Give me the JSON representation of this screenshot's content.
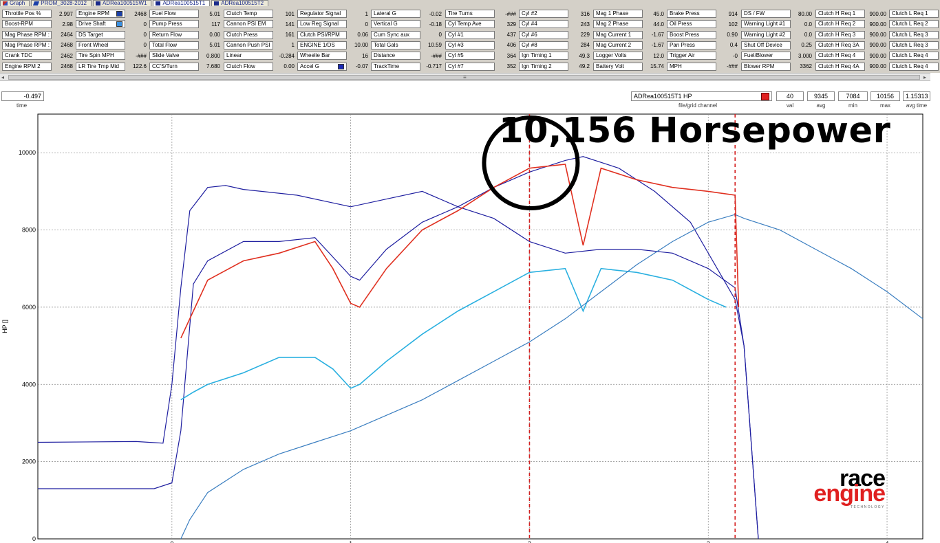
{
  "tabs": [
    {
      "label": "Graph",
      "icon": "graph-icon",
      "active": false
    },
    {
      "label": "PROM_3028-2012",
      "icon": "pencil-icon",
      "active": false
    },
    {
      "label": "ADRea100515W1",
      "icon": "box-icon",
      "active": false
    },
    {
      "label": "ADRea100515T1",
      "icon": "box-icon",
      "active": true
    },
    {
      "label": "ADRea100515T2",
      "icon": "box-icon",
      "active": false
    }
  ],
  "channel_grid": [
    [
      {
        "label": "Throttle Pos %",
        "value": "2.997"
      },
      {
        "label": "Boost-RPM",
        "value": "2.98"
      },
      {
        "label": "Mag Phase RPM :",
        "value": "2464"
      },
      {
        "label": "Mag Phase RPM :",
        "value": "2468"
      },
      {
        "label": "Crank TDC",
        "value": "2462"
      },
      {
        "label": "Engine RPM 2",
        "value": "2468"
      }
    ],
    [
      {
        "label": "Engine RPM",
        "value": "2468",
        "swatch": "#1a3fa8"
      },
      {
        "label": "Drive Shaft",
        "value": "0",
        "swatch": "#3a8fe0"
      },
      {
        "label": "DS Target",
        "value": "0"
      },
      {
        "label": "Front Wheel",
        "value": "0"
      },
      {
        "label": "Tire Spin MPH",
        "value": "-###"
      },
      {
        "label": "LR Tire Tmp Mid",
        "value": "122.6"
      }
    ],
    [
      {
        "label": "Fuel Flow",
        "value": "5.01"
      },
      {
        "label": "Pump Press",
        "value": "117"
      },
      {
        "label": "Return Flow",
        "value": "0.00"
      },
      {
        "label": "Total Flow",
        "value": "5.01"
      },
      {
        "label": "Slide Valve",
        "value": "0.800"
      },
      {
        "label": "CC'S/Turn",
        "value": "7.680"
      }
    ],
    [
      {
        "label": "Clutch Temp",
        "value": "101"
      },
      {
        "label": "Cannon PSI EM",
        "value": "141"
      },
      {
        "label": "Clutch Press",
        "value": "161"
      },
      {
        "label": "Cannon Push PSI",
        "value": "1"
      },
      {
        "label": "Linear",
        "value": "-0.284"
      },
      {
        "label": "Clutch Flow",
        "value": "0.00"
      }
    ],
    [
      {
        "label": "Regulator Signal",
        "value": "1"
      },
      {
        "label": "Low Reg Signal",
        "value": "0"
      },
      {
        "label": "Clutch PSI/RPM",
        "value": "0.06"
      },
      {
        "label": "ENGINE 1/DS",
        "value": "10.00"
      },
      {
        "label": "Wheelie Bar",
        "value": "16"
      },
      {
        "label": "Accel G",
        "value": "-0.07",
        "swatch": "#1a2ab8"
      }
    ],
    [
      {
        "label": "Lateral G",
        "value": "-0.02"
      },
      {
        "label": "Vertical G",
        "value": "-0.18"
      },
      {
        "label": "Cum Sync aux",
        "value": "0"
      },
      {
        "label": "Total Gals",
        "value": "10.59"
      },
      {
        "label": "Distance",
        "value": "-###"
      },
      {
        "label": "TrackTime",
        "value": "-0.717"
      }
    ],
    [
      {
        "label": "Tire Turns",
        "value": "-###"
      },
      {
        "label": "Cyl Temp Ave",
        "value": "329"
      },
      {
        "label": "Cyl #1",
        "value": "437"
      },
      {
        "label": "Cyl #3",
        "value": "406"
      },
      {
        "label": "Cyl #5",
        "value": "364"
      },
      {
        "label": "Cyl #7",
        "value": "352"
      }
    ],
    [
      {
        "label": "Cyl #2",
        "value": "316"
      },
      {
        "label": "Cyl #4",
        "value": "243"
      },
      {
        "label": "Cyl #6",
        "value": "229"
      },
      {
        "label": "Cyl #8",
        "value": "284"
      },
      {
        "label": "Ign Timing 1",
        "value": "49.3"
      },
      {
        "label": "Ign Timing 2",
        "value": "49.2"
      }
    ],
    [
      {
        "label": "Mag 1 Phase",
        "value": "45.0"
      },
      {
        "label": "Mag 2 Phase",
        "value": "44.0"
      },
      {
        "label": "Mag Current 1",
        "value": "-1.67"
      },
      {
        "label": "Mag Current 2",
        "value": "-1.67"
      },
      {
        "label": "Logger Volts",
        "value": "12.0"
      },
      {
        "label": "Battery Volt",
        "value": "15.74"
      }
    ],
    [
      {
        "label": "Brake Press",
        "value": "914"
      },
      {
        "label": "Oil Press",
        "value": "102"
      },
      {
        "label": "Boost Press",
        "value": "0.90"
      },
      {
        "label": "Pan Press",
        "value": "0.4"
      },
      {
        "label": "Trigger Air",
        "value": "-0"
      },
      {
        "label": "MPH",
        "value": "-###"
      }
    ],
    [
      {
        "label": "DS / FW",
        "value": "80.00"
      },
      {
        "label": "Warning Light #1",
        "value": "0.0"
      },
      {
        "label": "Warning Light #2",
        "value": "0.0"
      },
      {
        "label": "Shut Off Device",
        "value": "0.25"
      },
      {
        "label": "Fuel/Blower",
        "value": "3.000"
      },
      {
        "label": "Blower RPM",
        "value": "3362"
      }
    ],
    [
      {
        "label": "Clutch H Req 1",
        "value": "900.00"
      },
      {
        "label": "Clutch H Req 2",
        "value": "900.00"
      },
      {
        "label": "Clutch H Req 3",
        "value": "900.00"
      },
      {
        "label": "Clutch H Req 3A",
        "value": "900.00"
      },
      {
        "label": "Clutch H Req 4",
        "value": "900.00"
      },
      {
        "label": "Clutch H Req 4A",
        "value": "900.00"
      }
    ],
    [
      {
        "label": "Clutch L Req 1",
        "value": ""
      },
      {
        "label": "Clutch L Req 2",
        "value": ""
      },
      {
        "label": "Clutch L Req 3",
        "value": ""
      },
      {
        "label": "Clutch L Req 3",
        "value": ""
      },
      {
        "label": "Clutch L Req 4",
        "value": ""
      },
      {
        "label": "Clutch L Req 4",
        "value": ""
      }
    ]
  ],
  "scrollbar": {
    "left_arrow": "◂",
    "right_arrow": "▸",
    "grip": "≡"
  },
  "readout": {
    "time_value": "-0.497",
    "time_caption": "time",
    "file_channel": "ADRea100515T1      HP",
    "file_caption": "file/grid channel",
    "channel_color": "#e02020",
    "stats": [
      {
        "value": "40",
        "caption": "val"
      },
      {
        "value": "9345",
        "caption": "avg"
      },
      {
        "value": "7084",
        "caption": "min"
      },
      {
        "value": "10156",
        "caption": "max"
      },
      {
        "value": "1.15313",
        "caption": "avg time"
      }
    ]
  },
  "annotation": {
    "headline": "10,156 Horsepower"
  },
  "logo": {
    "line1": "race",
    "line2": "engine",
    "line3": "TECHNOLOGY"
  },
  "chart_data": {
    "type": "line",
    "ylabel": "HP []",
    "ylim": [
      0,
      11000
    ],
    "xlim": [
      -0.75,
      4.2
    ],
    "y_ticks": [
      0,
      2000,
      4000,
      6000,
      8000,
      10000
    ],
    "x_ticks": [
      "0",
      "1",
      "2",
      "3",
      "4"
    ],
    "grid": true,
    "cursor_lines_x": [
      2.0,
      3.15
    ],
    "highlight_circle": {
      "x": 2.0,
      "y": 9700
    },
    "series": [
      {
        "color": "#1f1fa0",
        "x": [
          -0.75,
          -0.2,
          -0.05,
          0.0,
          0.05,
          0.1,
          0.2,
          0.3,
          0.4,
          0.5,
          0.7,
          0.9,
          1.0,
          1.2,
          1.4,
          1.6,
          1.8,
          2.0,
          2.2,
          2.4,
          2.6,
          2.8,
          3.0,
          3.15,
          3.2,
          3.28
        ],
        "y": [
          2500,
          2520,
          2480,
          4000,
          6500,
          8500,
          9100,
          9150,
          9050,
          9000,
          8900,
          8700,
          8600,
          8800,
          9000,
          8600,
          8300,
          7700,
          7400,
          7500,
          7500,
          7400,
          7000,
          6500,
          5000,
          0
        ]
      },
      {
        "color": "#1f1fa0",
        "x": [
          -0.75,
          -0.1,
          0.0,
          0.05,
          0.12,
          0.2,
          0.4,
          0.6,
          0.8,
          0.9,
          1.0,
          1.05,
          1.2,
          1.4,
          1.6,
          1.8,
          2.0,
          2.2,
          2.3,
          2.5,
          2.7,
          2.9,
          3.05,
          3.15,
          3.2,
          3.28
        ],
        "y": [
          1300,
          1300,
          1450,
          2800,
          6600,
          7200,
          7700,
          7700,
          7800,
          7300,
          6800,
          6700,
          7500,
          8200,
          8600,
          9100,
          9500,
          9800,
          9900,
          9600,
          9000,
          8200,
          7000,
          6200,
          5000,
          0
        ]
      },
      {
        "color": "#e03020",
        "x": [
          0.05,
          0.12,
          0.2,
          0.4,
          0.6,
          0.8,
          0.9,
          1.0,
          1.05,
          1.2,
          1.4,
          1.6,
          1.8,
          2.0,
          2.2,
          2.3,
          2.4,
          2.6,
          2.8,
          3.0,
          3.15,
          3.17
        ],
        "y": [
          5200,
          5900,
          6700,
          7200,
          7400,
          7700,
          7000,
          6100,
          6000,
          7000,
          8000,
          8500,
          9100,
          9600,
          9700,
          7600,
          9600,
          9300,
          9100,
          9000,
          8900,
          6000
        ]
      },
      {
        "color": "#2ab0e0",
        "x": [
          0.05,
          0.12,
          0.2,
          0.4,
          0.6,
          0.8,
          0.9,
          1.0,
          1.05,
          1.2,
          1.4,
          1.6,
          1.8,
          2.0,
          2.2,
          2.3,
          2.4,
          2.6,
          2.8,
          3.0,
          3.1
        ],
        "y": [
          3600,
          3800,
          4000,
          4300,
          4700,
          4700,
          4400,
          3900,
          4000,
          4600,
          5300,
          5900,
          6400,
          6900,
          7000,
          5900,
          7000,
          6900,
          6700,
          6200,
          6000
        ]
      },
      {
        "color": "#3a7ec0",
        "x": [
          0.05,
          0.1,
          0.2,
          0.4,
          0.6,
          0.8,
          1.0,
          1.2,
          1.4,
          1.6,
          1.8,
          2.0,
          2.2,
          2.4,
          2.6,
          2.8,
          3.0,
          3.15,
          3.2,
          3.4,
          3.6,
          3.8,
          4.0,
          4.2
        ],
        "y": [
          0,
          500,
          1200,
          1800,
          2200,
          2500,
          2800,
          3200,
          3600,
          4100,
          4600,
          5100,
          5700,
          6400,
          7100,
          7700,
          8200,
          8400,
          8300,
          8000,
          7500,
          7000,
          6400,
          5700
        ]
      }
    ]
  }
}
